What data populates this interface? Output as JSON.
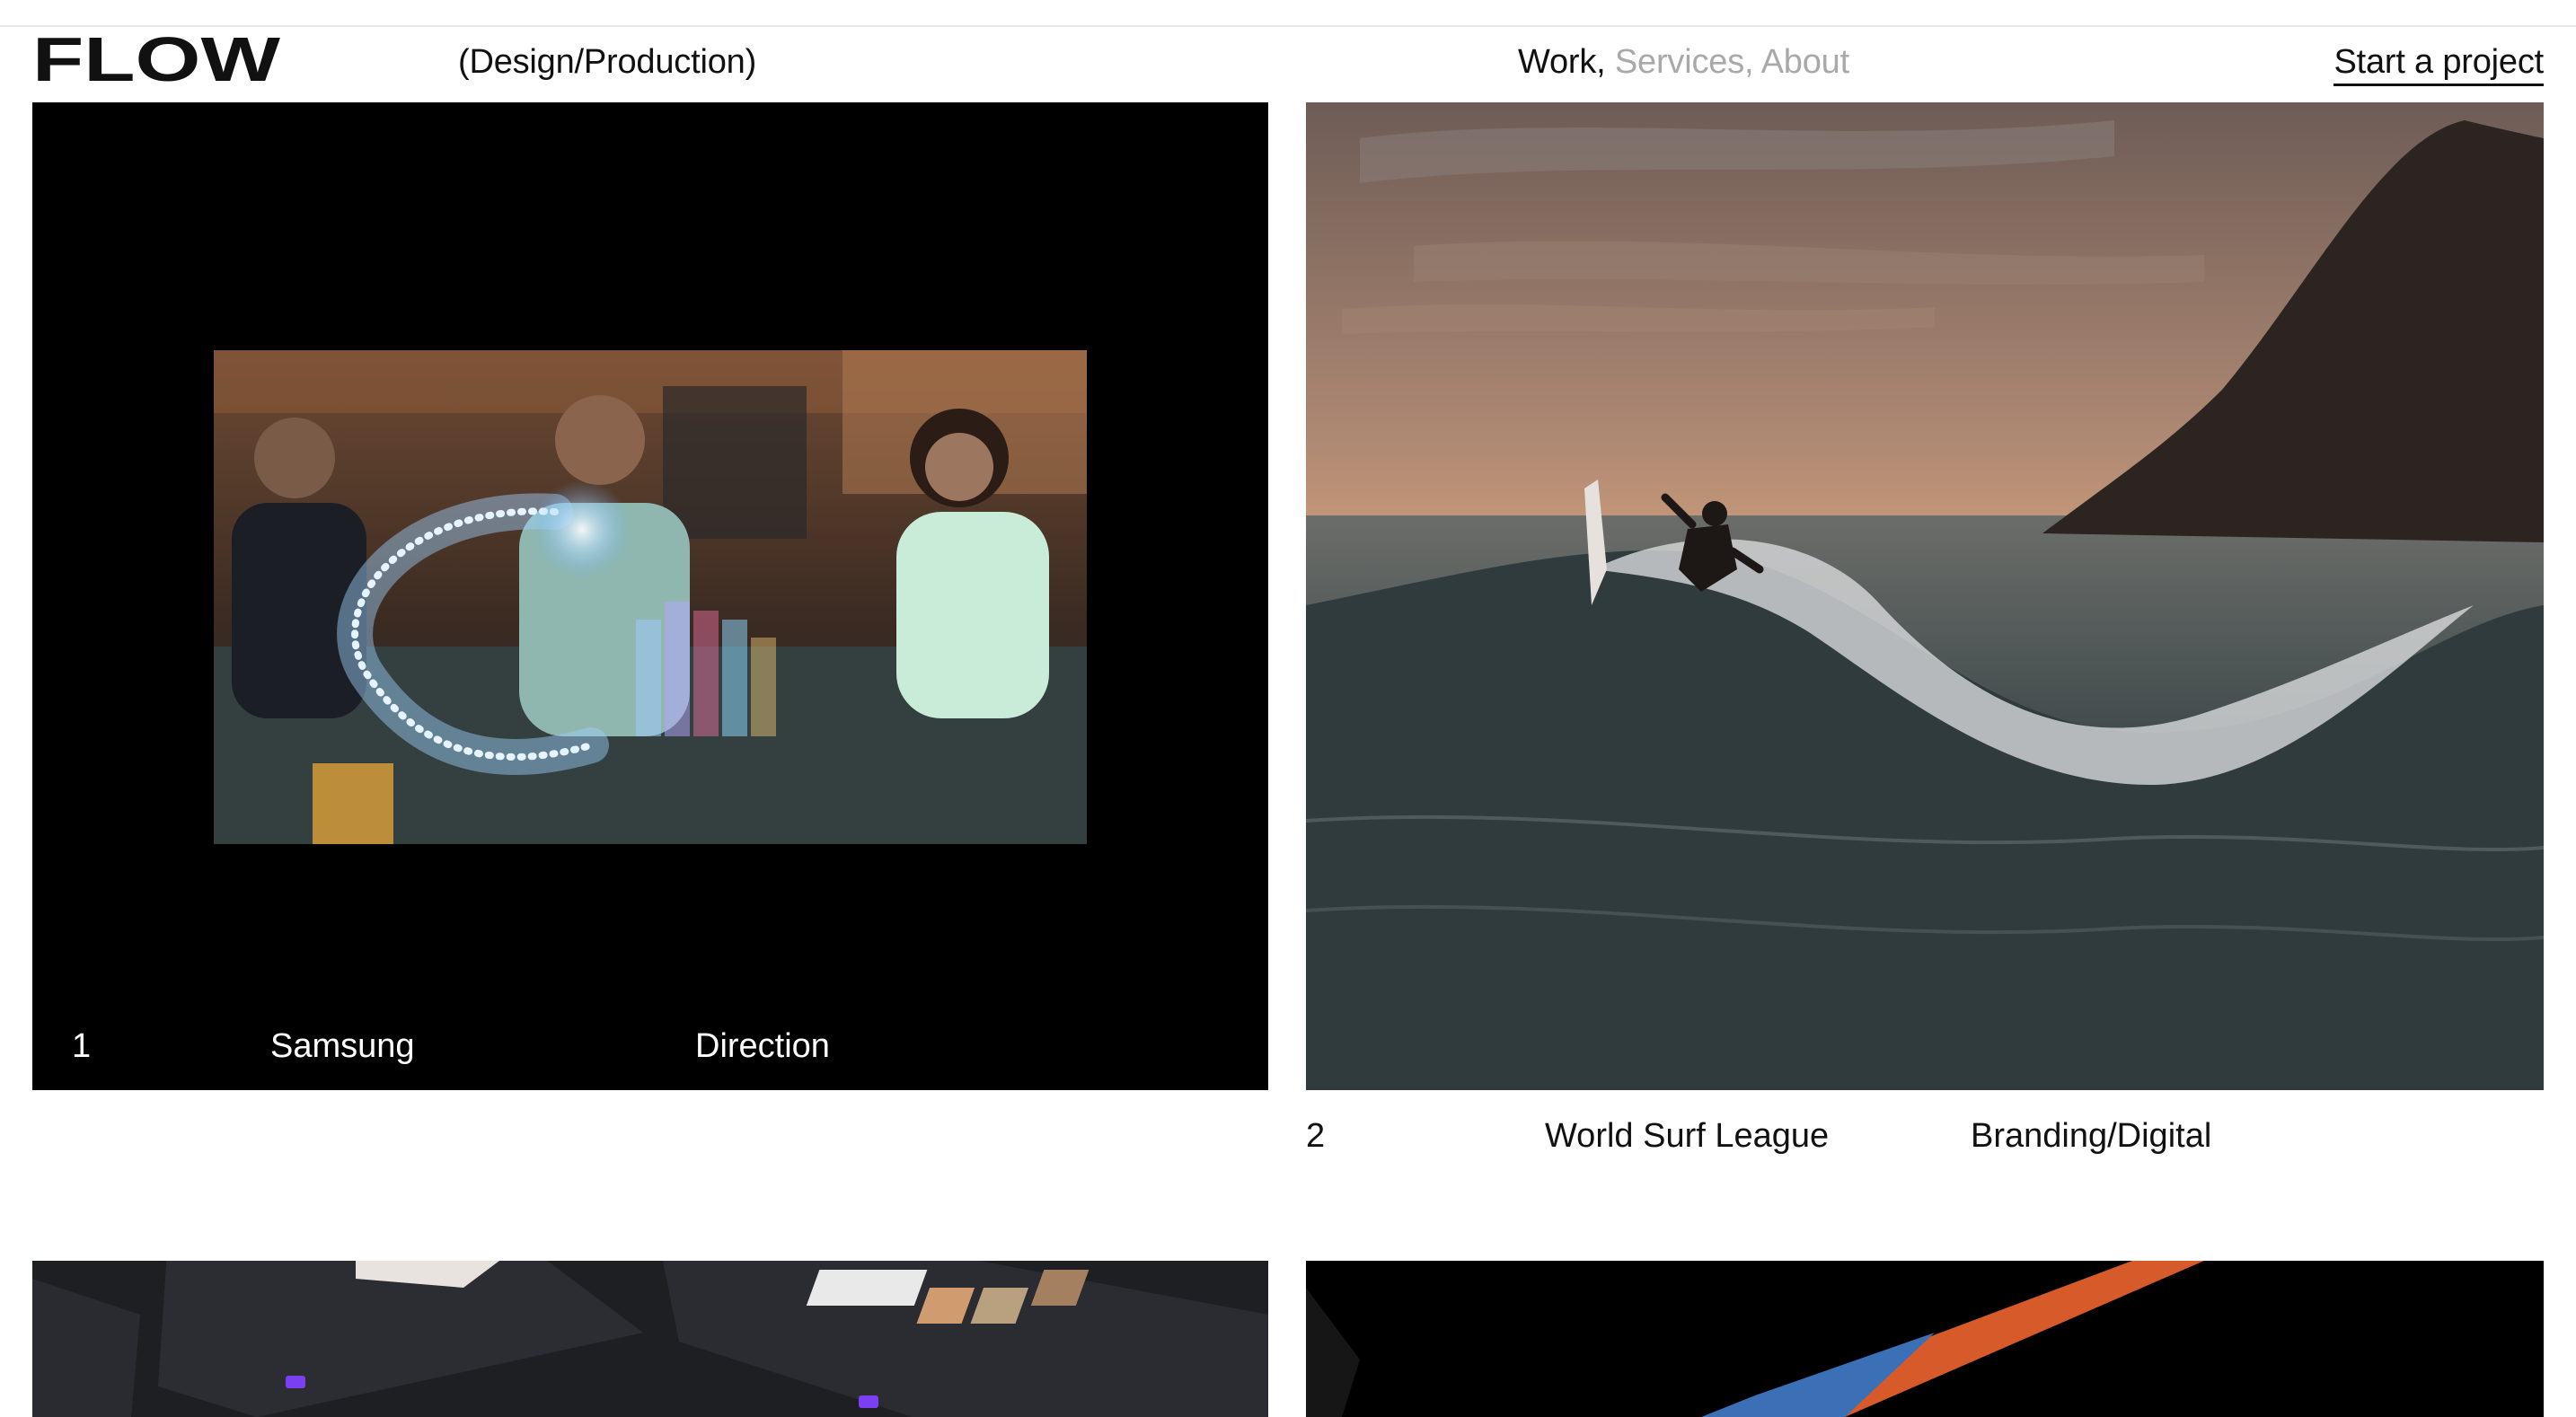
{
  "header": {
    "logo_text": "FLOW",
    "tagline": "(Design/Production)",
    "nav": {
      "work": "Work,",
      "services": "Services,",
      "about": "About"
    },
    "cta": "Start a project"
  },
  "projects": [
    {
      "number": "1",
      "client": "Samsung",
      "discipline": "Direction"
    },
    {
      "number": "2",
      "client": "World Surf League",
      "discipline": "Branding/Digital"
    }
  ],
  "colors": {
    "text": "#111111",
    "muted_nav": "#a9a9a9",
    "accent_purple": "#7b3ff2",
    "accent_orange": "#d75a2b",
    "accent_blue": "#3b6fb6"
  }
}
